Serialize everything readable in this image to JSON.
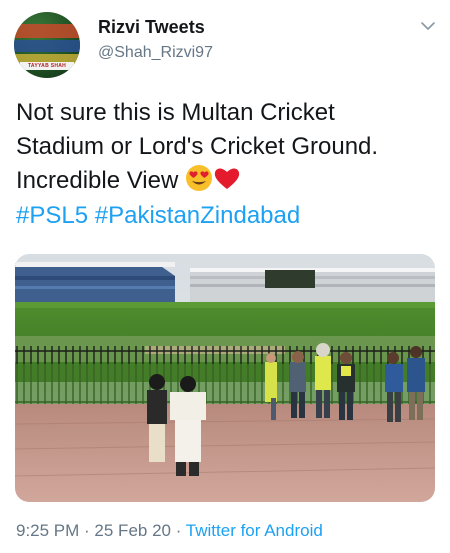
{
  "author": {
    "name": "Rizvi Tweets",
    "handle": "@Shah_Rizvi97",
    "avatar_text": "TAYYAB SHAH"
  },
  "tweet": {
    "line1": "Not sure this is Multan Cricket",
    "line2": "Stadium or Lord's Cricket Ground.",
    "line3": "Incredible View",
    "emojis": [
      "smiling-face-with-heart-eyes-icon",
      "red-heart-icon"
    ],
    "hashtags": [
      "#PSL5",
      "#PakistanZindabad"
    ]
  },
  "meta": {
    "time": "9:25 PM",
    "separator1": " · ",
    "date": "25 Feb 20",
    "separator2": " · ",
    "client": "Twitter for Android"
  },
  "colors": {
    "link": "#1da1f2",
    "secondary": "#657786",
    "text": "#14171a"
  }
}
